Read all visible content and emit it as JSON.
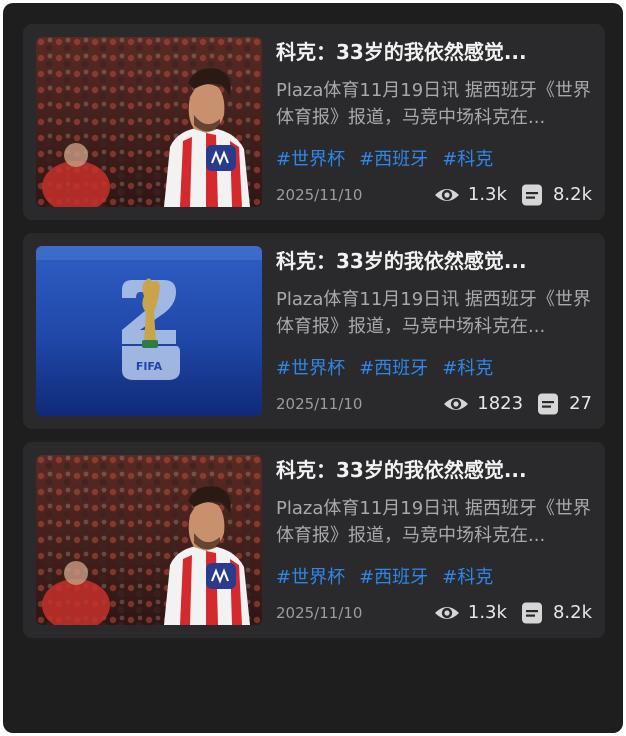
{
  "articles": [
    {
      "thumbnail": "player-photo",
      "title": "科克：33岁的我依然感觉...",
      "description": "Plaza体育11月19日讯 据西班牙《世界体育报》报道，马竞中场科克在...",
      "tags": [
        "#世界杯",
        "#西班牙",
        "#科克"
      ],
      "date": "2025/11/10",
      "views": "1.3k",
      "comments": "8.2k"
    },
    {
      "thumbnail": "fifa-2026-logo",
      "title": "科克：33岁的我依然感觉...",
      "description": "Plaza体育11月19日讯 据西班牙《世界体育报》报道，马竞中场科克在...",
      "tags": [
        "#世界杯",
        "#西班牙",
        "#科克"
      ],
      "date": "2025/11/10",
      "views": "1823",
      "comments": "27",
      "logo_text": "FIFA"
    },
    {
      "thumbnail": "player-photo",
      "title": "科克：33岁的我依然感觉...",
      "description": "Plaza体育11月19日讯 据西班牙《世界体育报》报道，马竞中场科克在...",
      "tags": [
        "#世界杯",
        "#西班牙",
        "#科克"
      ],
      "date": "2025/11/10",
      "views": "1.3k",
      "comments": "8.2k"
    }
  ],
  "icons": {
    "views": "eye-icon",
    "comments": "comment-icon"
  },
  "colors": {
    "background": "#1e1e1f",
    "card": "#2a2a2c",
    "tag": "#2f86e6",
    "title": "#f2f2f2",
    "description": "#a9a9ab"
  }
}
